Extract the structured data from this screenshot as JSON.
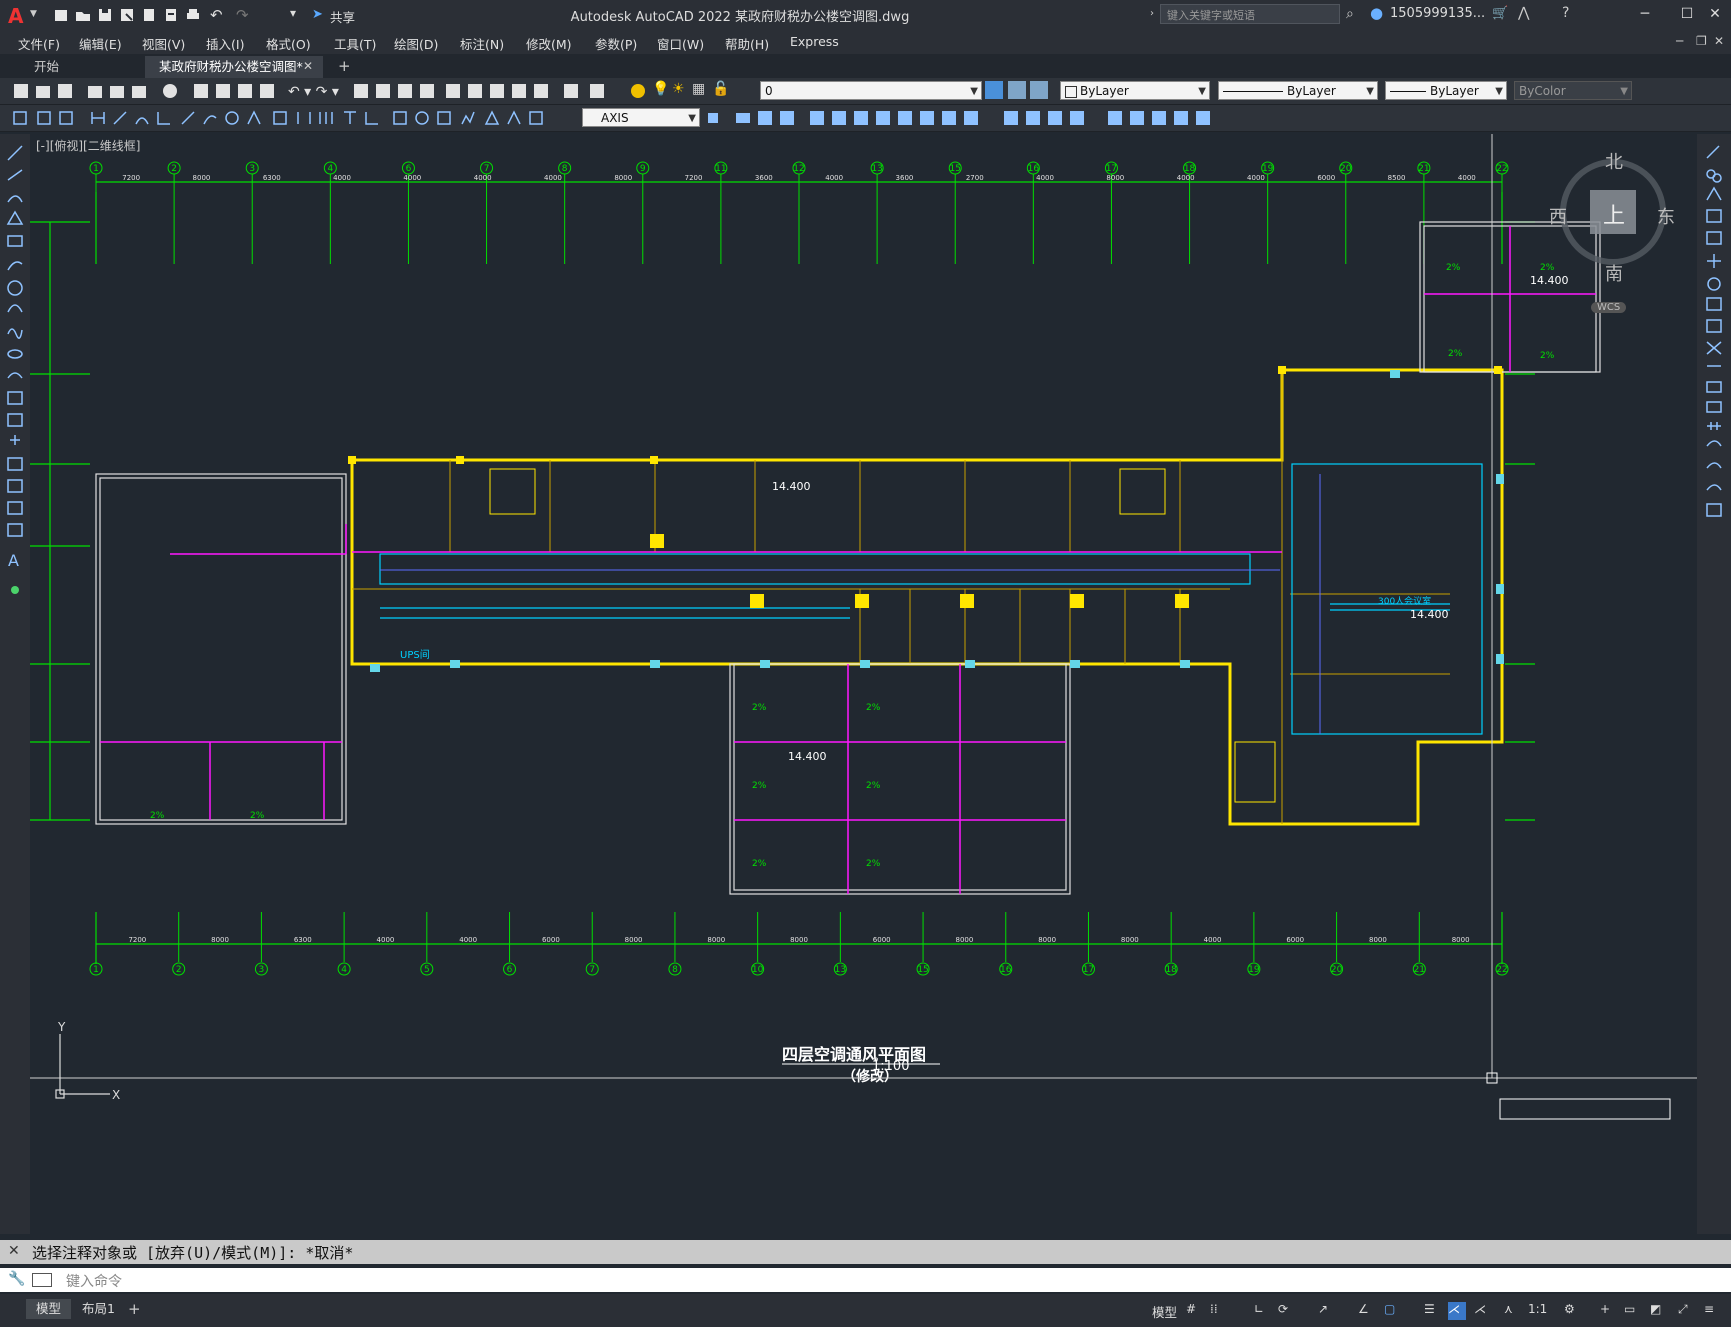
{
  "app": {
    "window_title": "Autodesk AutoCAD 2022    某政府财税办公楼空调图.dwg",
    "share_label": "共享",
    "search_placeholder": "键入关键字或短语",
    "user_name": "1505999135...",
    "menu_items": [
      "文件(F)",
      "编辑(E)",
      "视图(V)",
      "插入(I)",
      "格式(O)",
      "工具(T)",
      "绘图(D)",
      "标注(N)",
      "修改(M)",
      "参数(P)",
      "窗口(W)",
      "帮助(H)",
      "Express"
    ],
    "tabs": [
      "开始",
      "某政府财税办公楼空调图*"
    ],
    "layer_value": "0",
    "color_value": "ByLayer",
    "linetype_value": "ByLayer",
    "lineweight_value": "ByLayer",
    "plotstyle_value": "ByColor",
    "dimstyle_value": "AXIS",
    "view_label": "[-][俯视][二维线框]"
  },
  "viewcube": {
    "north": "北",
    "south": "南",
    "east": "东",
    "west": "西",
    "top": "上",
    "wcs": "WCS"
  },
  "drawing": {
    "title": "四层空调通风平面图",
    "scale": "1:100",
    "subtitle": "（修改）",
    "elevations": [
      "14.400",
      "14.400",
      "14.400",
      "14.400"
    ],
    "axis_top": [
      "1",
      "2",
      "3",
      "4",
      "6",
      "7",
      "8",
      "9",
      "11",
      "12",
      "13",
      "15",
      "16",
      "17",
      "18",
      "19",
      "20",
      "21",
      "22"
    ],
    "axis_bottom": [
      "1",
      "2",
      "3",
      "4",
      "5",
      "6",
      "7",
      "8",
      "10",
      "13",
      "15",
      "16",
      "17",
      "18",
      "19",
      "20",
      "21",
      "22"
    ],
    "dims_top": [
      "7200",
      "8000",
      "6300",
      "4000",
      "4000",
      "4000",
      "4000",
      "8000",
      "7200",
      "3600",
      "4000",
      "3600",
      "2700",
      "4000",
      "8000",
      "4000",
      "4000",
      "6000",
      "8500",
      "4000"
    ],
    "dims_bottom": [
      "7200",
      "8000",
      "6300",
      "4000",
      "4000",
      "6000",
      "8000",
      "8000",
      "8000",
      "6000",
      "8000",
      "8000",
      "8000",
      "4000",
      "6000",
      "8000",
      "8000"
    ],
    "slope_label": "2%",
    "ups_label": "UPS间",
    "room_note": "300人会议室"
  },
  "command": {
    "history": "选择注释对象或 [放弃(U)/模式(M)]: *取消*",
    "placeholder": "键入命令"
  },
  "status": {
    "layout_tabs": [
      "模型",
      "布局1"
    ],
    "model_label": "模型",
    "scale_label": "1:1"
  }
}
